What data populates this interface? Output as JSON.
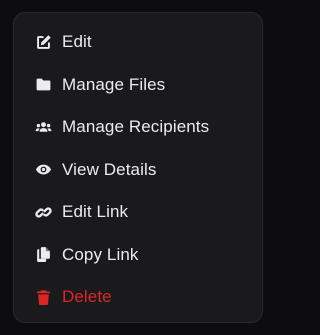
{
  "menu": {
    "items": [
      {
        "label": "Edit",
        "icon": "pencil-square-icon"
      },
      {
        "label": "Manage Files",
        "icon": "folder-icon"
      },
      {
        "label": "Manage Recipients",
        "icon": "users-icon"
      },
      {
        "label": "View Details",
        "icon": "eye-icon"
      },
      {
        "label": "Edit Link",
        "icon": "link-icon"
      },
      {
        "label": "Copy Link",
        "icon": "copy-icon"
      },
      {
        "label": "Delete",
        "icon": "trash-icon"
      }
    ]
  },
  "colors": {
    "background": "#0d0d0f",
    "menu_surface": "#1a1a1c",
    "text": "#ececee",
    "danger": "#dc2626"
  }
}
